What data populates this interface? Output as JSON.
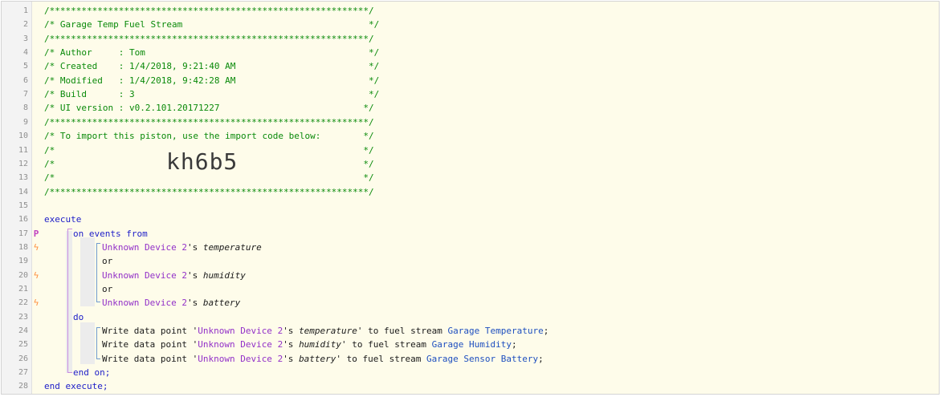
{
  "header": {
    "border_line": "/************************************************************/",
    "title": "/* Garage Temp Fuel Stream                                   */",
    "author": "/* Author     : Tom                                          */",
    "created": "/* Created    : 1/4/2018, 9:21:40 AM                         */",
    "modified": "/* Modified   : 1/4/2018, 9:42:28 AM                         */",
    "build": "/* Build      : 3                                            */",
    "ui_version": "/* UI version : v0.2.101.20171227                           */",
    "import_hint": "/* To import this piston, use the import code below:        */",
    "blank_comment": "/*                                                          */",
    "open_comment": "/*",
    "close_comment": "*/",
    "import_code": "kh6b5"
  },
  "code": {
    "execute": "execute",
    "on_events_from": "on events from",
    "device": "Unknown Device ",
    "device_num": "2",
    "possessive": "'s ",
    "attr_temperature": "temperature",
    "attr_humidity": "humidity",
    "attr_battery": "battery",
    "or": "or",
    "do": "do",
    "write_prefix": "Write data point '",
    "to_fuel": "' to fuel stream ",
    "stream_temperature": "Garage Temperature",
    "stream_humidity": "Garage Humidity",
    "stream_battery": "Garage Sensor Battery",
    "semicolon": ";",
    "end_on": "end on;",
    "end_execute": "end execute;"
  },
  "gutter": {
    "line_numbers": [
      "1",
      "2",
      "3",
      "4",
      "5",
      "6",
      "7",
      "8",
      "9",
      "10",
      "11",
      "12",
      "13",
      "14",
      "15",
      "16",
      "17",
      "18",
      "19",
      "20",
      "21",
      "22",
      "23",
      "24",
      "25",
      "26",
      "27",
      "28"
    ],
    "trigger_marker": "P",
    "bolt_marker": "ϟ"
  },
  "colors": {
    "background": "#fefcea",
    "comment": "#0a8a0a",
    "keyword": "#1d1dc8",
    "device": "#9230c8",
    "stream": "#1e4fbf",
    "bolt": "#ff8c3a"
  }
}
